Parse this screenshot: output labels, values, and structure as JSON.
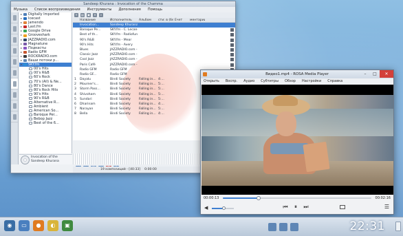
{
  "music_player": {
    "title": "Sandeep Khurana : Invocation of the Chamma",
    "menu": [
      "Музыка",
      "Список воспроизведения",
      "Инструменты",
      "Дополнения",
      "Помощь"
    ],
    "columns": {
      "num": "",
      "title": "Название",
      "artist": "Исполнитель",
      "album": "Альбом",
      "length": "сти: в (без учета)",
      "source": "Ечет",
      "comment": "ментарии"
    },
    "tree": [
      {
        "label": "Digitally Imported",
        "level": 0,
        "color": "#4f7fb8"
      },
      {
        "label": "Icecast",
        "level": 0,
        "color": "#2a6fbf"
      },
      {
        "label": "Jamendo",
        "level": 0,
        "color": "#e0833a"
      },
      {
        "label": "Last.fm",
        "level": 0,
        "color": "#c62b2b"
      },
      {
        "label": "Google Drive",
        "level": 0,
        "color": "#3aa657"
      },
      {
        "label": "Grooveshark",
        "level": 0,
        "color": "#f0a020"
      },
      {
        "label": "JAZZRADIO.com",
        "level": 0,
        "color": "#35486a"
      },
      {
        "label": "Magnatune",
        "level": 0,
        "color": "#7a5aa8"
      },
      {
        "label": "Подкасты",
        "level": 0,
        "color": "#8a56c2"
      },
      {
        "label": "Radio GFM",
        "level": 0,
        "color": "#c8562f"
      },
      {
        "label": "ROCKRADIO.com",
        "level": 0,
        "color": "#3b3b3b"
      },
      {
        "label": "Ваши потоки р...",
        "level": 0,
        "color": "#5e86b5"
      },
      {
        "label": "SKY.fm",
        "level": 0,
        "color": "#2e8fd6",
        "selected": true
      },
      {
        "label": "00's Hits",
        "level": 1,
        "color": "#ffffff"
      },
      {
        "label": "00's R&B",
        "level": 1,
        "color": "#ffffff"
      },
      {
        "label": "60's Rock",
        "level": 1,
        "color": "#ffffff"
      },
      {
        "label": "70's (All) & Ne...",
        "level": 1,
        "color": "#ffffff"
      },
      {
        "label": "80's Dance",
        "level": 1,
        "color": "#ffffff"
      },
      {
        "label": "80's Rock Hits",
        "level": 1,
        "color": "#ffffff"
      },
      {
        "label": "90's Hits",
        "level": 1,
        "color": "#ffffff"
      },
      {
        "label": "90's R&B",
        "level": 1,
        "color": "#ffffff"
      },
      {
        "label": "Alternative R...",
        "level": 1,
        "color": "#ffffff"
      },
      {
        "label": "Ambient",
        "level": 1,
        "color": "#ffffff"
      },
      {
        "label": "American So...",
        "level": 1,
        "color": "#ffffff"
      },
      {
        "label": "Baroque Per...",
        "level": 1,
        "color": "#ffffff"
      },
      {
        "label": "Bebop Jazz",
        "level": 1,
        "color": "#ffffff"
      },
      {
        "label": "Best of the 6...",
        "level": 1,
        "color": "#ffffff"
      }
    ],
    "now_playing": [
      "Invocation of the",
      "Sandeep Khurana"
    ],
    "playlist": [
      {
        "num": "",
        "title": "Invocation...",
        "artist": "Sandeep Khurana",
        "album": "",
        "length": "",
        "source": "",
        "comment": "",
        "selected": true
      },
      {
        "num": "",
        "title": "Baroque Pe...",
        "artist": "SKY.fm - C. Lecander",
        "album": "",
        "length": "",
        "source": "",
        "comment": ""
      },
      {
        "num": "",
        "title": "Best of th...",
        "artist": "SKY.fm - Radiofun...",
        "album": "",
        "length": "",
        "source": "",
        "comment": ""
      },
      {
        "num": "",
        "title": "90's R&B",
        "artist": "SKY.fm - Mear",
        "album": "",
        "length": "",
        "source": "",
        "comment": ""
      },
      {
        "num": "",
        "title": "90's Hits",
        "artist": "SKY.fm - Avery",
        "album": "",
        "length": "",
        "source": "",
        "comment": ""
      },
      {
        "num": "",
        "title": "Blues",
        "artist": "JAZZRADIO.com - S...",
        "album": "",
        "length": "",
        "source": "",
        "comment": ""
      },
      {
        "num": "",
        "title": "Classic Jazz",
        "artist": "JAZZRADIO.com - S...",
        "album": "",
        "length": "",
        "source": "",
        "comment": ""
      },
      {
        "num": "",
        "title": "Cool Jazz",
        "artist": "JAZZRADIO.com - S...",
        "album": "",
        "length": "",
        "source": "",
        "comment": ""
      },
      {
        "num": "",
        "title": "Paris Café",
        "artist": "JAZZRADIO.com - S...",
        "album": "",
        "length": "",
        "source": "",
        "comment": ""
      },
      {
        "num": "",
        "title": "Radio GFM",
        "artist": "Radio GFM",
        "album": "",
        "length": "",
        "source": "",
        "comment": ""
      },
      {
        "num": "",
        "title": "Radio GF...",
        "artist": "Radio GFM",
        "album": "",
        "length": "",
        "source": "",
        "comment": ""
      },
      {
        "num": "1",
        "title": "Dayalu",
        "artist": "Bindi Society",
        "album": "Falling in...",
        "length": "4:...",
        "source": "",
        "comment": ""
      },
      {
        "num": "2",
        "title": "Mourner's...",
        "artist": "Bindi Society",
        "album": "Falling in...",
        "length": "5:...",
        "source": "",
        "comment": ""
      },
      {
        "num": "3",
        "title": "Storm Pass...",
        "artist": "Bindi Society",
        "album": "Falling in...",
        "length": "5:...",
        "source": "",
        "comment": ""
      },
      {
        "num": "4",
        "title": "Shivoham",
        "artist": "Bindi Society",
        "album": "Falling in...",
        "length": "5:...",
        "source": "",
        "comment": ""
      },
      {
        "num": "5",
        "title": "Sundari",
        "artist": "Bindi Society",
        "album": "Falling in...",
        "length": "5:...",
        "source": "",
        "comment": ""
      },
      {
        "num": "6",
        "title": "Dharinam",
        "artist": "Bindi Society",
        "album": "Falling in...",
        "length": "4:...",
        "source": "",
        "comment": ""
      },
      {
        "num": "7",
        "title": "Narayan",
        "artist": "Bindi Society",
        "album": "Falling in...",
        "length": "5:...",
        "source": "",
        "comment": ""
      },
      {
        "num": "8",
        "title": "Bella",
        "artist": "Bindi Society",
        "album": "Falling in...",
        "length": "4:...",
        "source": "",
        "comment": ""
      }
    ],
    "status": "19 композиций - [40:33]",
    "status_time": "0:00:00"
  },
  "video_player": {
    "title": "Видео1.mp4 - ROSA Media Player",
    "menu": [
      "Открыть",
      "Воспр.",
      "Аудио",
      "Субтитры",
      "Обзор",
      "Настройки",
      "Справка"
    ],
    "time_current": "00:00:13",
    "time_total": "00:02:16",
    "progress_fraction": 0.24,
    "volume_fraction": 0.55,
    "controls": {
      "prev": "⏮",
      "pause": "⏸",
      "next": "⏭",
      "menu": "☰",
      "volume": "◀"
    }
  },
  "taskbar": {
    "clock": "22:31"
  }
}
